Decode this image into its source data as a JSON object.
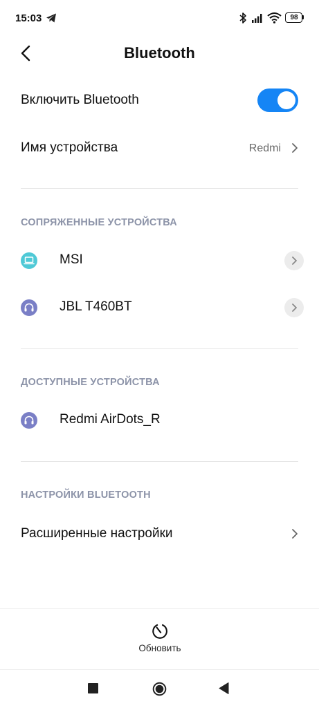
{
  "status_bar": {
    "time": "15:03",
    "battery": "98",
    "icons": [
      "telegram-icon",
      "bluetooth-icon",
      "signal-icon",
      "wifi-icon",
      "battery-icon"
    ]
  },
  "header": {
    "title": "Bluetooth",
    "back_icon": "chevron-left-icon"
  },
  "bluetooth_toggle": {
    "label": "Включить Bluetooth",
    "enabled": true,
    "accent_color": "#1585f5"
  },
  "device_name": {
    "label": "Имя устройства",
    "value": "Redmi"
  },
  "paired": {
    "header": "СОПРЯЖЕННЫЕ УСТРОЙСТВА",
    "devices": [
      {
        "name": "MSI",
        "icon": "laptop-icon",
        "icon_color": "#4fc9d6"
      },
      {
        "name": "JBL T460BT",
        "icon": "headset-icon",
        "icon_color": "#7a7fc6"
      }
    ]
  },
  "available": {
    "header": "ДОСТУПНЫЕ УСТРОЙСТВА",
    "devices": [
      {
        "name": "Redmi AirDots_R",
        "icon": "headset-icon",
        "icon_color": "#7a7fc6"
      }
    ]
  },
  "settings": {
    "header": "НАСТРОЙКИ BLUETOOTH",
    "advanced_label": "Расширенные настройки"
  },
  "refresh": {
    "label": "Обновить"
  },
  "nav": {
    "icons": [
      "recents-square-icon",
      "home-circle-icon",
      "back-triangle-icon"
    ]
  }
}
